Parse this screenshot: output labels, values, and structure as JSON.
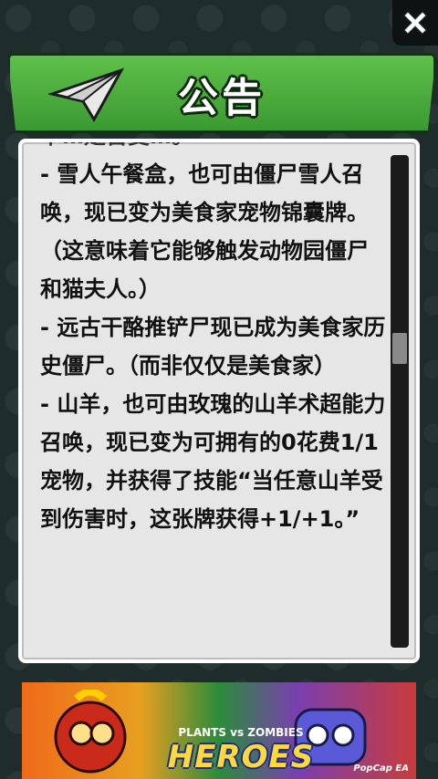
{
  "header": {
    "title": "公告"
  },
  "announcement": {
    "partial_top": "卡…是否变…。",
    "lines": [
      "- 雪人午餐盒，也可由僵尸雪人召唤，现已变为美食家宠物锦囊牌。（这意味着它能够触发动物园僵尸和猫夫人。）",
      "- 远古干酪推铲尸现已成为美食家历史僵尸。（而非仅仅是美食家）",
      "- 山羊，也可由玫瑰的山羊术超能力召唤，现已变为可拥有的0花费1/1宠物，并获得了技能“当任意山羊受到伤害时，这张牌获得+1/+1。”"
    ]
  },
  "scroll": {
    "position_fraction": 0.38
  },
  "ad_banner": {
    "plants_text": "PLANTS vs ZOMBIES",
    "heroes_text": "HEROES",
    "brand": "PopCap EA"
  },
  "icons": {
    "close": "close-icon",
    "plane": "paper-plane-icon"
  },
  "colors": {
    "header_green": "#4caf3f",
    "panel_bg": "#e6e6e6"
  }
}
